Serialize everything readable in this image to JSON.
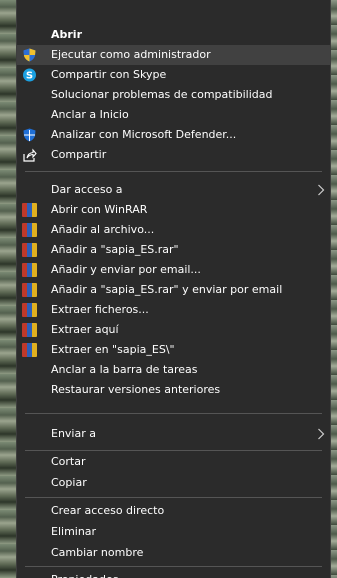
{
  "menu": {
    "open": "Abrir",
    "run_as_admin": "Ejecutar como administrador",
    "share_skype": "Compartir con Skype",
    "troubleshoot": "Solucionar problemas de compatibilidad",
    "pin_start": "Anclar a Inicio",
    "scan_defender": "Analizar con Microsoft Defender...",
    "share": "Compartir",
    "give_access": "Dar acceso a",
    "open_winrar": "Abrir con WinRAR",
    "add_archive": "Añadir al archivo...",
    "add_to_rar": "Añadir a \"sapia_ES.rar\"",
    "add_email": "Añadir y enviar por email...",
    "add_rar_email": "Añadir a \"sapia_ES.rar\" y enviar por email",
    "extract_files": "Extraer ficheros...",
    "extract_here": "Extraer aquí",
    "extract_to": "Extraer en \"sapia_ES\\\"",
    "pin_taskbar": "Anclar a la barra de tareas",
    "restore_versions": "Restaurar versiones anteriores",
    "send_to": "Enviar a",
    "cut": "Cortar",
    "copy": "Copiar",
    "create_shortcut": "Crear acceso directo",
    "delete": "Eliminar",
    "rename": "Cambiar nombre",
    "properties": "Propiedades"
  },
  "colors": {
    "menu_bg": "#2b2b2b",
    "highlight_bg": "#414141",
    "text": "#ffffff",
    "separator": "#555555",
    "skype_blue": "#1ba1e2",
    "defender_blue": "#1f6fd6"
  },
  "icons": {
    "run_as_admin": "uac-shield-icon",
    "share_skype": "skype-icon",
    "scan_defender": "defender-shield-icon",
    "share": "share-icon",
    "winrar": "winrar-icon",
    "submenu": "chevron-right-icon"
  }
}
